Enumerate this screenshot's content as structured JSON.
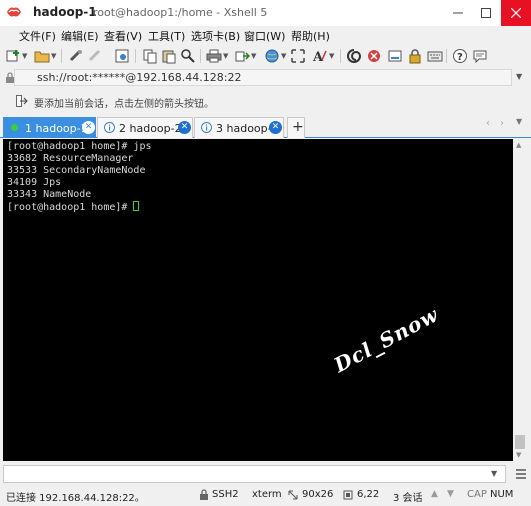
{
  "window": {
    "title": "hadoop-1",
    "subtitle": "root@hadoop1:/home - Xshell 5"
  },
  "menu": [
    "文件(F)",
    "编辑(E)",
    "查看(V)",
    "工具(T)",
    "选项卡(B)",
    "窗口(W)",
    "帮助(H)"
  ],
  "address": {
    "value": "ssh://root:******@192.168.44.128:22"
  },
  "hint": {
    "text": "要添加当前会话，点击左侧的箭头按钮。"
  },
  "tabs": [
    {
      "label": "1 hadoop-1",
      "active": true
    },
    {
      "label": "2 hadoop-2",
      "active": false
    },
    {
      "label": "3 hadoop-3",
      "active": false
    }
  ],
  "terminal": {
    "lines": [
      "[root@hadoop1 home]# jps",
      "33682 ResourceManager",
      "33533 SecondaryNameNode",
      "34109 Jps",
      "33343 NameNode"
    ],
    "prompt": "[root@hadoop1 home]# ",
    "watermark": "Dcl_Snow"
  },
  "status": {
    "connection": "已连接 192.168.44.128:22。",
    "protocol": "SSH2",
    "terminal_type": "xterm",
    "size": "90x26",
    "cursor_pos": "6,22",
    "sessions": "3 会话",
    "caps": "CAP",
    "num": "NUM"
  },
  "colors": {
    "tab_active": "#3b8fe0",
    "close_button": "#e81123",
    "terminal_bg": "#000000",
    "cursor": "#39d339"
  }
}
